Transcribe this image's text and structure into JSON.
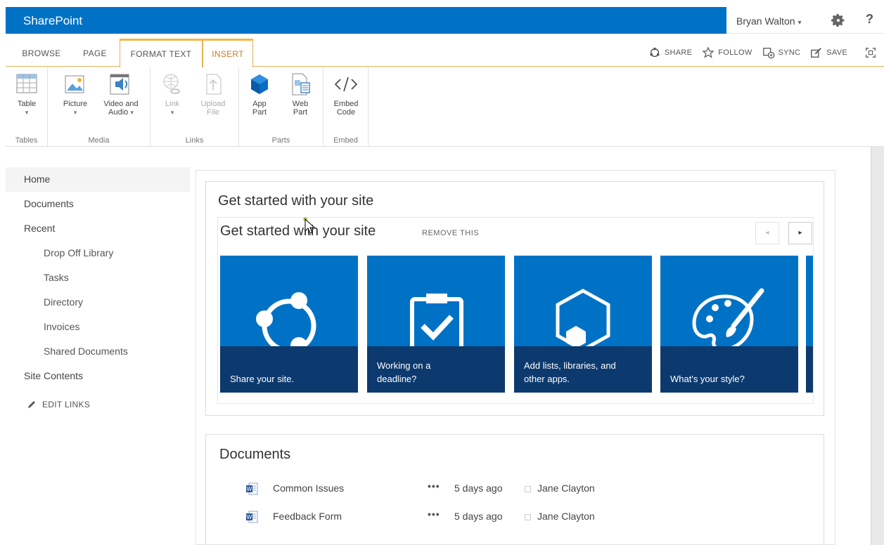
{
  "suitebar": {
    "brand": "SharePoint",
    "user": "Bryan Walton",
    "user_caret": "▾",
    "help": "?",
    "color": "#0072c6"
  },
  "tabs": [
    {
      "label": "BROWSE"
    },
    {
      "label": "PAGE"
    },
    {
      "label": "FORMAT TEXT"
    },
    {
      "label": "INSERT"
    }
  ],
  "actions": {
    "share": "SHARE",
    "follow": "FOLLOW",
    "sync": "SYNC",
    "save": "SAVE"
  },
  "ribbon": {
    "groups": {
      "tables": "Tables",
      "media": "Media",
      "links": "Links",
      "parts": "Parts",
      "embed": "Embed"
    },
    "buttons": {
      "table": "Table",
      "picture": "Picture",
      "video_line1": "Video and",
      "video_line2": "Audio",
      "link": "Link",
      "upload_line1": "Upload",
      "upload_line2": "File",
      "app_line1": "App",
      "app_line2": "Part",
      "web_line1": "Web",
      "web_line2": "Part",
      "embed_line1": "Embed",
      "embed_line2": "Code",
      "caret": "▾"
    }
  },
  "nav": {
    "home": "Home",
    "documents": "Documents",
    "recent": "Recent",
    "recent_items": [
      "Drop Off Library",
      "Tasks",
      "Directory",
      "Invoices",
      "Shared Documents"
    ],
    "site_contents": "Site Contents",
    "edit_links": "EDIT LINKS"
  },
  "get_started": {
    "title": "Get started with your site",
    "inner_title": "Get started with your site",
    "remove": "REMOVE THIS",
    "prev": "◂",
    "next": "▸",
    "tiles": [
      {
        "line1": "Share your site.",
        "line2": ""
      },
      {
        "line1": "Working on a",
        "line2": "deadline?"
      },
      {
        "line1": "Add lists, libraries, and",
        "line2": "other apps."
      },
      {
        "line1": "What's your style?",
        "line2": ""
      }
    ],
    "tile_color": "#0072c6",
    "band_color": "#0d3a6e"
  },
  "documents": {
    "title": "Documents",
    "rows": [
      {
        "name": "Common Issues",
        "more": "•••",
        "modified": "5 days ago",
        "author": "Jane Clayton"
      },
      {
        "name": "Feedback Form",
        "more": "•••",
        "modified": "5 days ago",
        "author": "Jane Clayton"
      }
    ]
  }
}
